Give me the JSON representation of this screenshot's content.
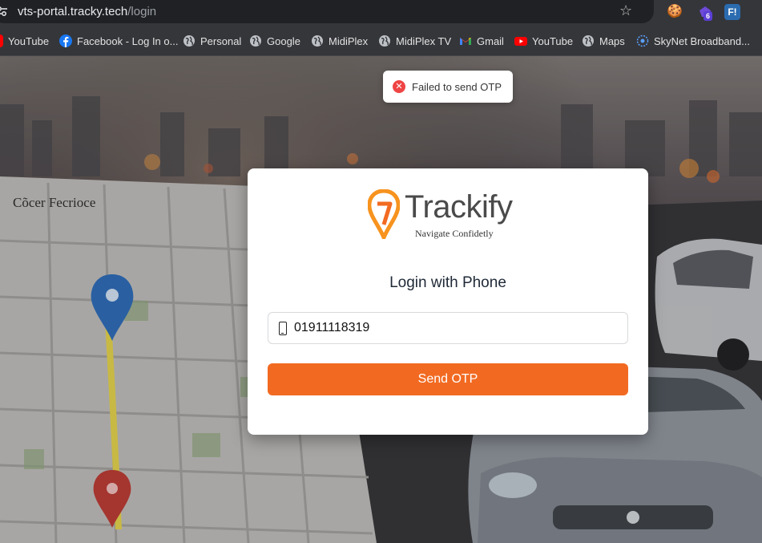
{
  "browser": {
    "url_host": "vts-portal.tracky.tech",
    "url_path": "/login",
    "extension_badge": "6",
    "extension_label": "F!"
  },
  "bookmarks": [
    {
      "label": "YouTube",
      "icon": "youtube-icon"
    },
    {
      "label": "Facebook - Log In o...",
      "icon": "facebook-icon"
    },
    {
      "label": "Personal",
      "icon": "globe-icon"
    },
    {
      "label": "Google",
      "icon": "globe-icon"
    },
    {
      "label": "MidiPlex",
      "icon": "globe-icon"
    },
    {
      "label": "MidiPlex TV",
      "icon": "globe-icon"
    },
    {
      "label": "Gmail",
      "icon": "gmail-icon"
    },
    {
      "label": "YouTube",
      "icon": "youtube-icon"
    },
    {
      "label": "Maps",
      "icon": "globe-icon"
    },
    {
      "label": "SkyNet Broadband...",
      "icon": "skynet-icon"
    }
  ],
  "toast": {
    "message": "Failed to send OTP",
    "type": "error"
  },
  "login": {
    "brand": "Trackify",
    "tagline": "Navigate Confidetly",
    "heading": "Login with Phone",
    "phone_value": "01911118319",
    "submit_label": "Send OTP"
  },
  "background": {
    "map_caption": "Cõcer Fecrioce"
  },
  "colors": {
    "accent": "#f26a22",
    "error": "#ef4444",
    "logo_orange": "#f7931e"
  }
}
